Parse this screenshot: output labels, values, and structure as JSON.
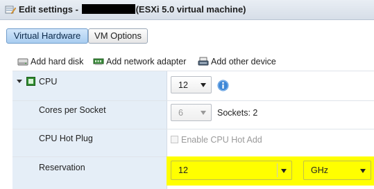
{
  "window": {
    "title_prefix": "Edit settings - ",
    "title_suffix": "(ESXi 5.0 virtual machine)"
  },
  "tabs": [
    {
      "label": "Virtual Hardware",
      "active": true
    },
    {
      "label": "VM Options",
      "active": false
    }
  ],
  "toolbar": {
    "add_hard_disk": "Add hard disk",
    "add_network_adapter": "Add network adapter",
    "add_other_device": "Add other device"
  },
  "hardware": {
    "cpu": {
      "label": "CPU",
      "value": "12",
      "info_icon": "info-icon"
    },
    "cores_per_socket": {
      "label": "Cores per Socket",
      "value": "6",
      "sockets_text": "Sockets: 2"
    },
    "cpu_hot_plug": {
      "label": "CPU Hot Plug",
      "checkbox_label": "Enable CPU Hot Add",
      "checked": false
    },
    "reservation": {
      "label": "Reservation",
      "value": "12",
      "unit": "GHz"
    }
  },
  "colors": {
    "highlight": "#ffff00",
    "active_tab": "#a9cdf0",
    "left_column": "#e5eef7",
    "info_icon": "#3f87d6"
  }
}
